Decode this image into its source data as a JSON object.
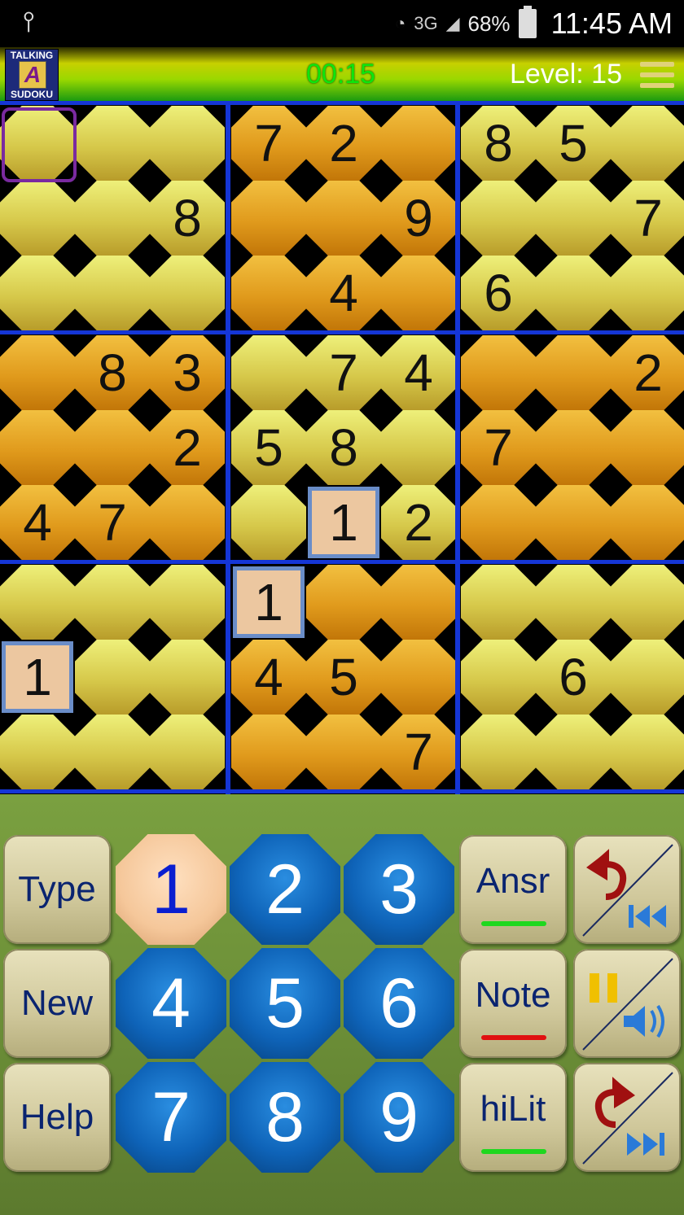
{
  "status_bar": {
    "network": "3G",
    "battery": "68%",
    "time": "11:45 AM"
  },
  "header": {
    "logo_top": "TALKING",
    "logo_letter": "A",
    "logo_bottom": "SUDOKU",
    "timer": "00:15",
    "level": "Level: 15"
  },
  "board": {
    "rows": [
      [
        "",
        "",
        "",
        "7",
        "2",
        "",
        "8",
        "5",
        ""
      ],
      [
        "",
        "",
        "8",
        "",
        "",
        "9",
        "",
        "",
        "7"
      ],
      [
        "",
        "",
        "",
        "",
        "4",
        "",
        "6",
        "",
        ""
      ],
      [
        "",
        "8",
        "3",
        "",
        "7",
        "4",
        "",
        "",
        "2"
      ],
      [
        "",
        "",
        "2",
        "5",
        "8",
        "",
        "7",
        "",
        ""
      ],
      [
        "4",
        "7",
        "",
        "",
        "1",
        "2",
        "",
        "",
        ""
      ],
      [
        "",
        "",
        "",
        "1",
        "",
        "",
        "",
        "",
        ""
      ],
      [
        "1",
        "",
        "",
        "4",
        "5",
        "",
        "",
        "6",
        ""
      ],
      [
        "",
        "",
        "",
        "",
        "",
        "7",
        "",
        "",
        ""
      ]
    ],
    "highlighted_digit": "1",
    "selected_cell": [
      0,
      0
    ]
  },
  "keypad": {
    "left_buttons": [
      "Type",
      "New",
      "Help"
    ],
    "digits": [
      "1",
      "2",
      "3",
      "4",
      "5",
      "6",
      "7",
      "8",
      "9"
    ],
    "active_digit": "1",
    "right_buttons": [
      {
        "label": "Ansr",
        "underline_color": "#1fd81f"
      },
      {
        "label": "Note",
        "underline_color": "#e01010"
      },
      {
        "label": "hiLit",
        "underline_color": "#1fd81f"
      }
    ],
    "control_icons": [
      "undo-first-icon",
      "pause-sound-icon",
      "redo-last-icon"
    ]
  }
}
